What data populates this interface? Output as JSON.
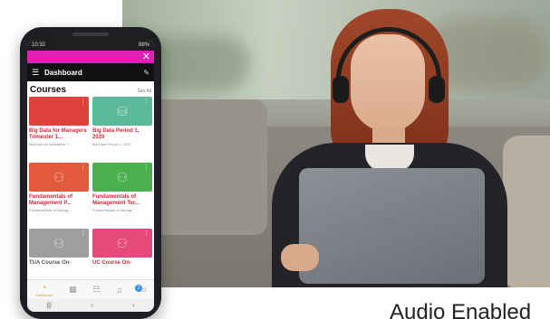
{
  "caption": "Audio Enabled",
  "phone": {
    "status_time": "10:32",
    "status_battery": "88%",
    "header_title": "Dashboard",
    "courses_heading": "Courses",
    "see_all": "See All",
    "courses": [
      {
        "title": "Big Data for Managers Trimester 1...",
        "subtitle": "Big Data for Managers T...",
        "color": "#e0403a",
        "icon": "none"
      },
      {
        "title": "Big Data Period 1, 2020",
        "subtitle": "Big Data Period 1, 2020",
        "color": "#5bb89a",
        "icon": "database-add-icon"
      },
      {
        "title": "Fundamentals of Management P...",
        "subtitle": "Fundamentals of Manag...",
        "color": "#e05a3b",
        "icon": "people-icon"
      },
      {
        "title": "Fundamentals of Management Ter...",
        "subtitle": "Fundamentals of Manag...",
        "color": "#4caf50",
        "icon": "people-icon"
      },
      {
        "title": "TUA Course On-",
        "subtitle": "",
        "color": "#9e9e9e",
        "icon": "people-icon"
      },
      {
        "title": "UC Course On-",
        "subtitle": "",
        "color": "#e64a7b",
        "icon": "people-icon"
      }
    ],
    "nav": {
      "dashboard_label": "Dashboard",
      "badge": "2"
    }
  }
}
